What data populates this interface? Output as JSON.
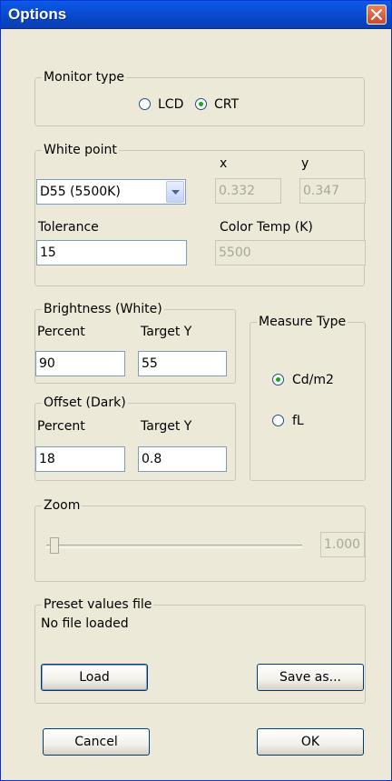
{
  "window": {
    "title": "Options"
  },
  "monitor_type": {
    "legend": "Monitor type",
    "options": [
      {
        "label": "LCD",
        "checked": false
      },
      {
        "label": "CRT",
        "checked": true
      }
    ]
  },
  "white_point": {
    "legend": "White point",
    "preset_value": "D55 (5500K)",
    "x_label": "x",
    "y_label": "y",
    "x_value": "0.332",
    "y_value": "0.347",
    "tolerance_label": "Tolerance",
    "tolerance_value": "15",
    "color_temp_label": "Color Temp (K)",
    "color_temp_value": "5500"
  },
  "brightness": {
    "legend": "Brightness (White)",
    "percent_label": "Percent",
    "percent_value": "90",
    "target_label": "Target Y",
    "target_value": "55"
  },
  "offset": {
    "legend": "Offset (Dark)",
    "percent_label": "Percent",
    "percent_value": "18",
    "target_label": "Target Y",
    "target_value": "0.8"
  },
  "measure_type": {
    "legend": "Measure Type",
    "options": [
      {
        "label": "Cd/m2",
        "checked": true
      },
      {
        "label": "fL",
        "checked": false
      }
    ]
  },
  "zoom": {
    "legend": "Zoom",
    "value": "1.000",
    "slider_fraction": 0.0
  },
  "preset_file": {
    "legend": "Preset values file",
    "status": "No file loaded",
    "load_label": "Load",
    "save_label": "Save as..."
  },
  "footer": {
    "cancel_label": "Cancel",
    "ok_label": "OK"
  }
}
